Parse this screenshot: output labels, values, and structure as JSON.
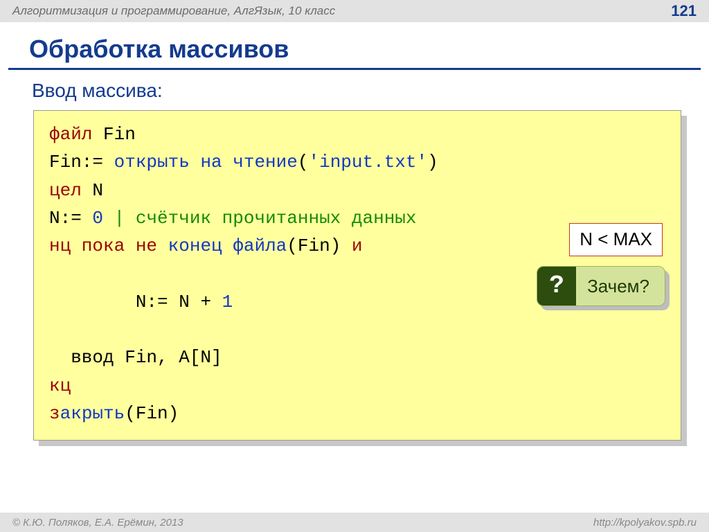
{
  "header": {
    "title": "Алгоритмизация и программирование, АлгЯзык, 10 класс",
    "page": "121"
  },
  "title": "Обработка массивов",
  "subtitle": "Ввод массива:",
  "code": {
    "l1": {
      "kw": "файл",
      "rest": " Fin"
    },
    "l2": {
      "a": "Fin:= ",
      "b": "открыть на чтение",
      "c": "(",
      "d": "'input.txt'",
      "e": ")"
    },
    "l3": {
      "kw": "цел",
      "rest": " N"
    },
    "l4": {
      "a": "N:= ",
      "b": "0",
      "c": "   | счётчик прочитанных данных"
    },
    "l5": {
      "a": "нц пока не",
      "b": " ",
      "c": "конец файла",
      "d": "(Fin) ",
      "e": "и"
    },
    "l6": {
      "a": "  N:= N + ",
      "b": "1"
    },
    "l7": "  ввод Fin, A[N]",
    "l8": "кц",
    "l9": {
      "a": "з",
      "b": "акрыть",
      "c": "(Fin)"
    }
  },
  "condition": "N < MAX",
  "callout": {
    "mark": "?",
    "text": "Зачем?"
  },
  "footer": {
    "left": "© К.Ю. Поляков, Е.А. Ерёмин, 2013",
    "right": "http://kpolyakov.spb.ru"
  }
}
